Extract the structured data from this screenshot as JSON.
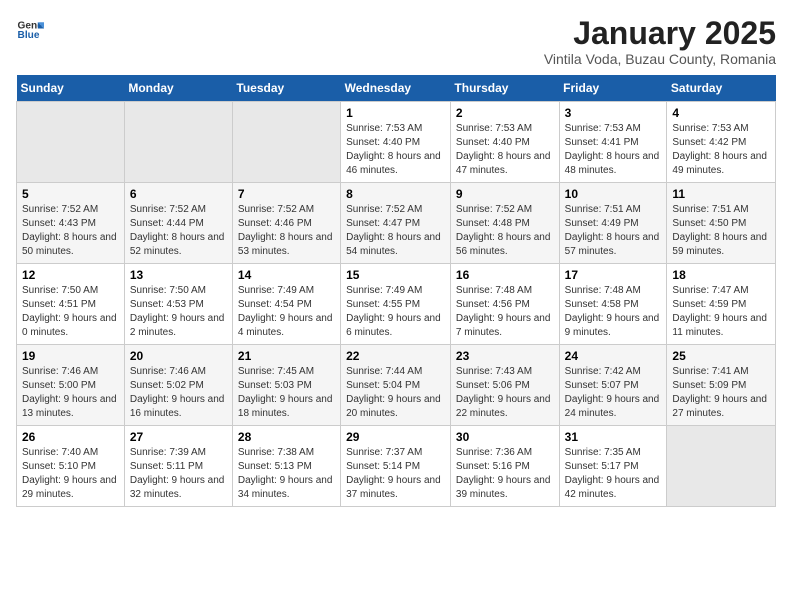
{
  "logo": {
    "line1": "General",
    "line2": "Blue"
  },
  "title": "January 2025",
  "subtitle": "Vintila Voda, Buzau County, Romania",
  "weekdays": [
    "Sunday",
    "Monday",
    "Tuesday",
    "Wednesday",
    "Thursday",
    "Friday",
    "Saturday"
  ],
  "weeks": [
    [
      {
        "day": "",
        "info": ""
      },
      {
        "day": "",
        "info": ""
      },
      {
        "day": "",
        "info": ""
      },
      {
        "day": "1",
        "info": "Sunrise: 7:53 AM\nSunset: 4:40 PM\nDaylight: 8 hours and 46 minutes."
      },
      {
        "day": "2",
        "info": "Sunrise: 7:53 AM\nSunset: 4:40 PM\nDaylight: 8 hours and 47 minutes."
      },
      {
        "day": "3",
        "info": "Sunrise: 7:53 AM\nSunset: 4:41 PM\nDaylight: 8 hours and 48 minutes."
      },
      {
        "day": "4",
        "info": "Sunrise: 7:53 AM\nSunset: 4:42 PM\nDaylight: 8 hours and 49 minutes."
      }
    ],
    [
      {
        "day": "5",
        "info": "Sunrise: 7:52 AM\nSunset: 4:43 PM\nDaylight: 8 hours and 50 minutes."
      },
      {
        "day": "6",
        "info": "Sunrise: 7:52 AM\nSunset: 4:44 PM\nDaylight: 8 hours and 52 minutes."
      },
      {
        "day": "7",
        "info": "Sunrise: 7:52 AM\nSunset: 4:46 PM\nDaylight: 8 hours and 53 minutes."
      },
      {
        "day": "8",
        "info": "Sunrise: 7:52 AM\nSunset: 4:47 PM\nDaylight: 8 hours and 54 minutes."
      },
      {
        "day": "9",
        "info": "Sunrise: 7:52 AM\nSunset: 4:48 PM\nDaylight: 8 hours and 56 minutes."
      },
      {
        "day": "10",
        "info": "Sunrise: 7:51 AM\nSunset: 4:49 PM\nDaylight: 8 hours and 57 minutes."
      },
      {
        "day": "11",
        "info": "Sunrise: 7:51 AM\nSunset: 4:50 PM\nDaylight: 8 hours and 59 minutes."
      }
    ],
    [
      {
        "day": "12",
        "info": "Sunrise: 7:50 AM\nSunset: 4:51 PM\nDaylight: 9 hours and 0 minutes."
      },
      {
        "day": "13",
        "info": "Sunrise: 7:50 AM\nSunset: 4:53 PM\nDaylight: 9 hours and 2 minutes."
      },
      {
        "day": "14",
        "info": "Sunrise: 7:49 AM\nSunset: 4:54 PM\nDaylight: 9 hours and 4 minutes."
      },
      {
        "day": "15",
        "info": "Sunrise: 7:49 AM\nSunset: 4:55 PM\nDaylight: 9 hours and 6 minutes."
      },
      {
        "day": "16",
        "info": "Sunrise: 7:48 AM\nSunset: 4:56 PM\nDaylight: 9 hours and 7 minutes."
      },
      {
        "day": "17",
        "info": "Sunrise: 7:48 AM\nSunset: 4:58 PM\nDaylight: 9 hours and 9 minutes."
      },
      {
        "day": "18",
        "info": "Sunrise: 7:47 AM\nSunset: 4:59 PM\nDaylight: 9 hours and 11 minutes."
      }
    ],
    [
      {
        "day": "19",
        "info": "Sunrise: 7:46 AM\nSunset: 5:00 PM\nDaylight: 9 hours and 13 minutes."
      },
      {
        "day": "20",
        "info": "Sunrise: 7:46 AM\nSunset: 5:02 PM\nDaylight: 9 hours and 16 minutes."
      },
      {
        "day": "21",
        "info": "Sunrise: 7:45 AM\nSunset: 5:03 PM\nDaylight: 9 hours and 18 minutes."
      },
      {
        "day": "22",
        "info": "Sunrise: 7:44 AM\nSunset: 5:04 PM\nDaylight: 9 hours and 20 minutes."
      },
      {
        "day": "23",
        "info": "Sunrise: 7:43 AM\nSunset: 5:06 PM\nDaylight: 9 hours and 22 minutes."
      },
      {
        "day": "24",
        "info": "Sunrise: 7:42 AM\nSunset: 5:07 PM\nDaylight: 9 hours and 24 minutes."
      },
      {
        "day": "25",
        "info": "Sunrise: 7:41 AM\nSunset: 5:09 PM\nDaylight: 9 hours and 27 minutes."
      }
    ],
    [
      {
        "day": "26",
        "info": "Sunrise: 7:40 AM\nSunset: 5:10 PM\nDaylight: 9 hours and 29 minutes."
      },
      {
        "day": "27",
        "info": "Sunrise: 7:39 AM\nSunset: 5:11 PM\nDaylight: 9 hours and 32 minutes."
      },
      {
        "day": "28",
        "info": "Sunrise: 7:38 AM\nSunset: 5:13 PM\nDaylight: 9 hours and 34 minutes."
      },
      {
        "day": "29",
        "info": "Sunrise: 7:37 AM\nSunset: 5:14 PM\nDaylight: 9 hours and 37 minutes."
      },
      {
        "day": "30",
        "info": "Sunrise: 7:36 AM\nSunset: 5:16 PM\nDaylight: 9 hours and 39 minutes."
      },
      {
        "day": "31",
        "info": "Sunrise: 7:35 AM\nSunset: 5:17 PM\nDaylight: 9 hours and 42 minutes."
      },
      {
        "day": "",
        "info": ""
      }
    ]
  ]
}
